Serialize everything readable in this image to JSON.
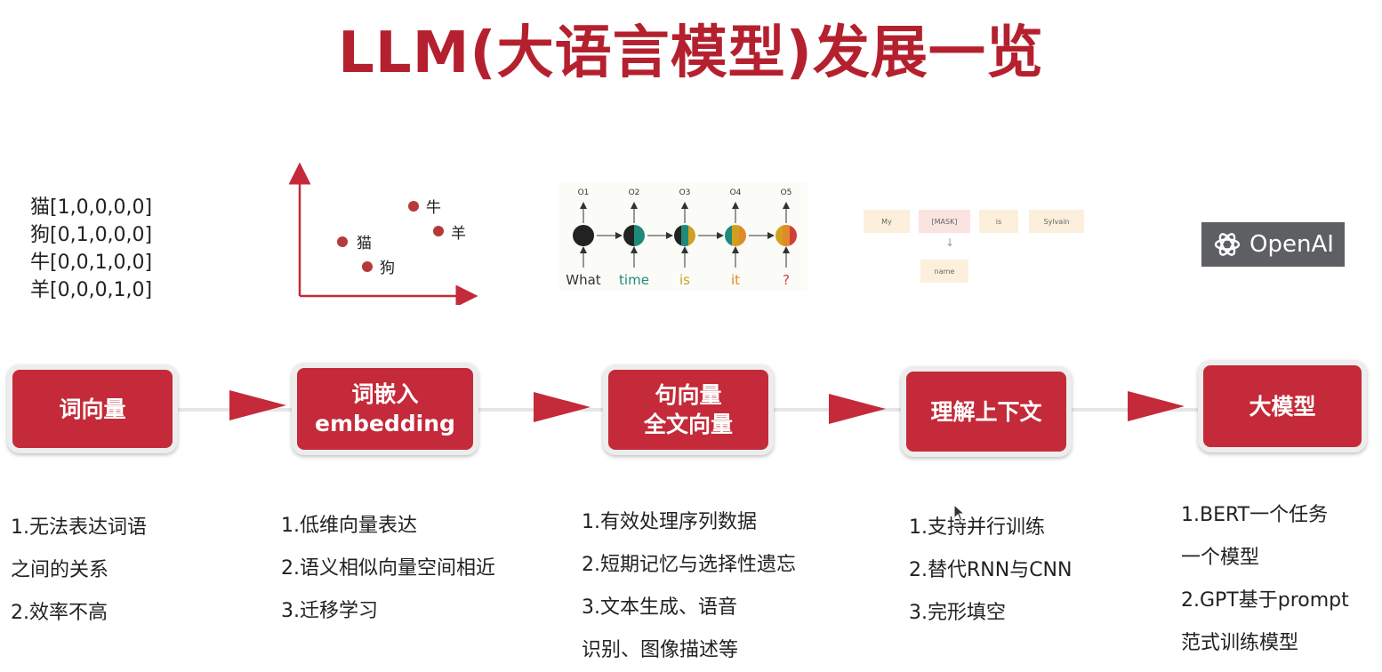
{
  "title": "LLM(大语言模型)发展一览",
  "onehot": [
    "猫[1,0,0,0,0]",
    "狗[0,1,0,0,0]",
    "牛[0,0,1,0,0]",
    "羊[0,0,0,1,0]"
  ],
  "scatter": {
    "points": [
      {
        "label": "牛"
      },
      {
        "label": "羊"
      },
      {
        "label": "猫"
      },
      {
        "label": "狗"
      }
    ]
  },
  "rnn": {
    "outputs": [
      "O1",
      "O2",
      "O3",
      "O4",
      "O5"
    ],
    "words": [
      "What",
      "time",
      "is",
      "it",
      "?"
    ],
    "word_colors": [
      "#333333",
      "#1f8a7a",
      "#d2a020",
      "#e08a2a",
      "#d0403a"
    ]
  },
  "bert": {
    "tokens": [
      "My",
      "[MASK]",
      "is",
      "Sylvain"
    ],
    "prediction": "name",
    "arrow": "↓"
  },
  "openai": {
    "label": "OpenAI"
  },
  "stages": [
    {
      "lines": [
        "词向量"
      ]
    },
    {
      "lines": [
        "词嵌入",
        "embedding"
      ]
    },
    {
      "lines": [
        "句向量",
        "全文向量"
      ]
    },
    {
      "lines": [
        "理解上下文"
      ]
    },
    {
      "lines": [
        "大模型"
      ]
    }
  ],
  "notes": [
    [
      "1.无法表达词语",
      "之间的关系",
      "2.效率不高"
    ],
    [
      "1.低维向量表达",
      "2.语义相似向量空间相近",
      "3.迁移学习"
    ],
    [
      "1.有效处理序列数据",
      "2.短期记忆与选择性遗忘",
      "3.文本生成、语音",
      "识别、图像描述等"
    ],
    [
      "1.支持并行训练",
      "2.替代RNN与CNN",
      "3.完形填空"
    ],
    [
      "1.BERT一个任务",
      "一个模型",
      "2.GPT基于prompt",
      "范式训练模型"
    ]
  ],
  "colors": {
    "accent": "#c42a39",
    "title": "#b5202e",
    "dot": "#b53a3a"
  }
}
